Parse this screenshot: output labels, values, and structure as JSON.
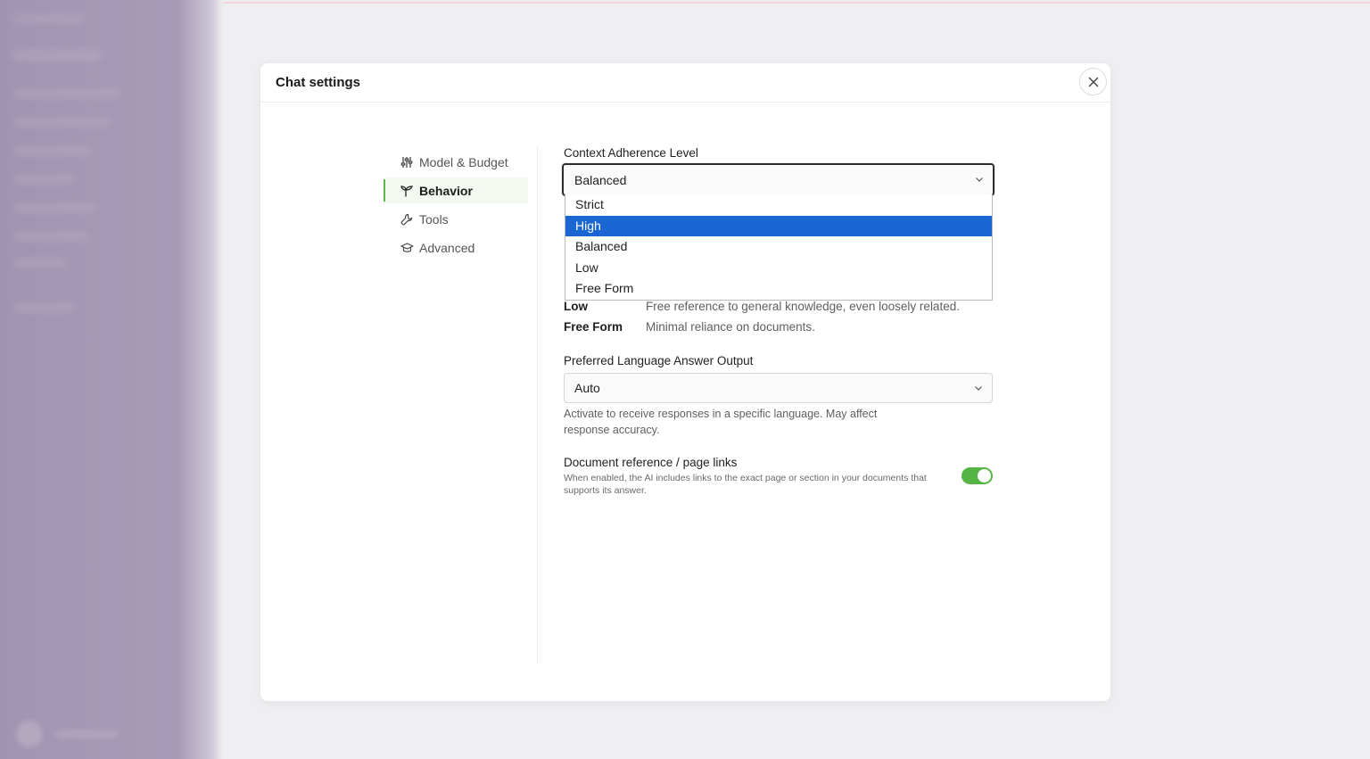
{
  "modal": {
    "title": "Chat settings"
  },
  "nav": {
    "items": [
      {
        "label": "Model & Budget",
        "icon": "sliders-icon"
      },
      {
        "label": "Behavior",
        "icon": "sprout-icon",
        "active": true
      },
      {
        "label": "Tools",
        "icon": "wrench-icon"
      },
      {
        "label": "Advanced",
        "icon": "graduation-cap-icon"
      }
    ]
  },
  "context_adherence": {
    "label": "Context Adherence Level",
    "selected": "Balanced",
    "options": [
      "Strict",
      "High",
      "Balanced",
      "Low",
      "Free Form"
    ],
    "highlighted_option": "High",
    "descriptions": [
      {
        "term": "Low",
        "definition": "Free reference to general knowledge, even loosely related."
      },
      {
        "term": "Free Form",
        "definition": "Minimal reliance on documents."
      }
    ]
  },
  "language": {
    "label": "Preferred Language Answer Output",
    "selected": "Auto",
    "help_line1": "Activate to receive responses in a specific language. May affect",
    "help_line2": "response accuracy."
  },
  "doc_reference": {
    "label": "Document reference / page links",
    "help_line1": "When enabled, the AI includes links to the exact page or section in your documents that",
    "help_line2": "supports its answer.",
    "enabled": true
  },
  "colors": {
    "accent_green": "#55b544",
    "selected_option_blue": "#1a66d2",
    "backdrop_purple": "#a89bb8"
  }
}
